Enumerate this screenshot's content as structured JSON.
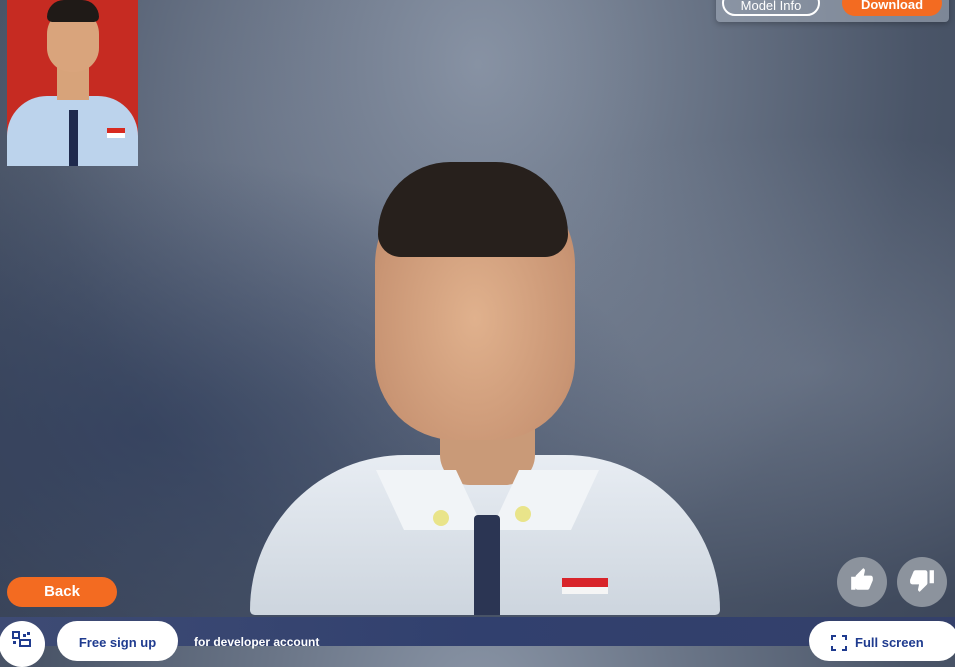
{
  "header": {
    "model_info_label": "Model Info",
    "download_label": "Download"
  },
  "viewer": {
    "source_photo_alt": "source photo",
    "model_alt": "3D head model"
  },
  "controls": {
    "back_label": "Back",
    "like_icon": "thumbs-up-icon",
    "dislike_icon": "thumbs-down-icon"
  },
  "footer": {
    "qr_icon": "qr-code-icon",
    "signup_label": "Free sign up",
    "developer_text": "for developer account",
    "fullscreen_label": "Full screen",
    "fullscreen_icon": "fullscreen-icon"
  },
  "colors": {
    "accent": "#f36b21",
    "footer_bar": "#34406a",
    "link_text": "#1f3b8f"
  }
}
